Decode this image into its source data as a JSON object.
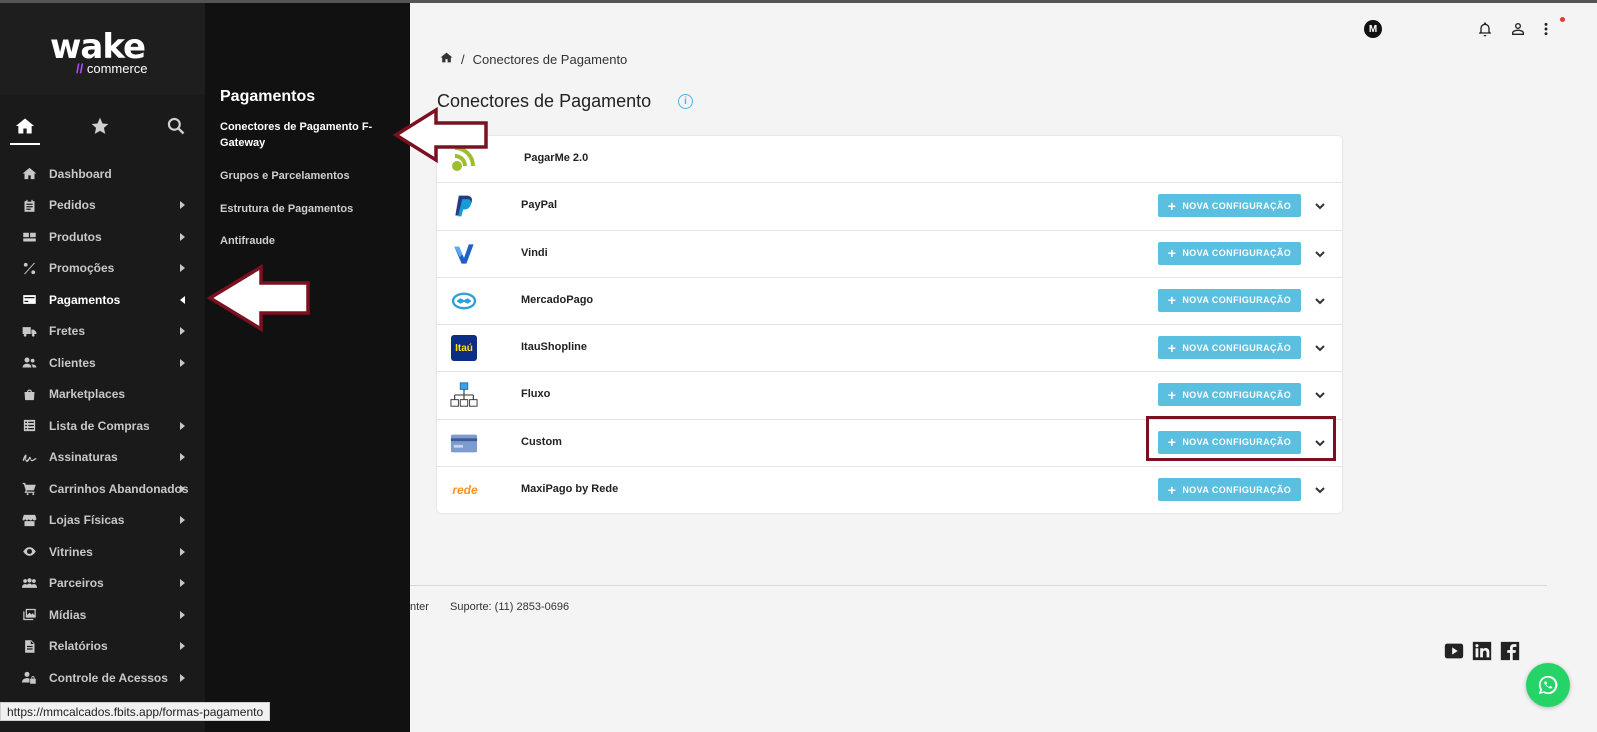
{
  "brand": {
    "logo_main": "wake",
    "logo_sub": "commerce",
    "logo_slash": "//"
  },
  "sidebar": {
    "tabs": [
      {
        "icon": "home-icon",
        "active": true
      },
      {
        "icon": "star-icon"
      },
      {
        "icon": "search-icon"
      }
    ],
    "items": [
      {
        "label": "Dashboard",
        "icon": "dashboard-icon",
        "has_sub": false
      },
      {
        "label": "Pedidos",
        "icon": "clipboard-icon",
        "has_sub": true
      },
      {
        "label": "Produtos",
        "icon": "boxes-icon",
        "has_sub": true
      },
      {
        "label": "Promoções",
        "icon": "percent-icon",
        "has_sub": true
      },
      {
        "label": "Pagamentos",
        "icon": "credit-card-icon",
        "has_sub": true,
        "active": true
      },
      {
        "label": "Fretes",
        "icon": "truck-icon",
        "has_sub": true
      },
      {
        "label": "Clientes",
        "icon": "users-icon",
        "has_sub": true
      },
      {
        "label": "Marketplaces",
        "icon": "shopping-bag-icon",
        "has_sub": false
      },
      {
        "label": "Lista de Compras",
        "icon": "list-icon",
        "has_sub": true
      },
      {
        "label": "Assinaturas",
        "icon": "signature-icon",
        "has_sub": true
      },
      {
        "label": "Carrinhos Abandonados",
        "icon": "cart-icon",
        "has_sub": true
      },
      {
        "label": "Lojas Físicas",
        "icon": "store-icon",
        "has_sub": true
      },
      {
        "label": "Vitrines",
        "icon": "eye-icon",
        "has_sub": true
      },
      {
        "label": "Parceiros",
        "icon": "partners-icon",
        "has_sub": true
      },
      {
        "label": "Mídias",
        "icon": "media-icon",
        "has_sub": true
      },
      {
        "label": "Relatórios",
        "icon": "report-icon",
        "has_sub": true
      },
      {
        "label": "Controle de Acessos",
        "icon": "user-lock-icon",
        "has_sub": true
      }
    ]
  },
  "submenu": {
    "title": "Pagamentos",
    "items": [
      {
        "label": "Conectores de Pagamento F-Gateway",
        "active": true
      },
      {
        "label": "Grupos e Parcelamentos"
      },
      {
        "label": "Estrutura de Pagamentos"
      },
      {
        "label": "Antifraude"
      }
    ]
  },
  "topbar": {
    "avatar_letter": "M"
  },
  "breadcrumb": {
    "current": "Conectores de Pagamento"
  },
  "page": {
    "title": "Conectores de Pagamento",
    "info_glyph": "i"
  },
  "connectors": {
    "button_label": "NOVA CONFIGURAÇÃO",
    "plus": "+",
    "rows": [
      {
        "name": "PagarMe 2.0",
        "logo": "pagarme-logo",
        "has_button": false
      },
      {
        "name": "PayPal",
        "logo": "paypal-logo",
        "has_button": true
      },
      {
        "name": "Vindi",
        "logo": "vindi-logo",
        "has_button": true
      },
      {
        "name": "MercadoPago",
        "logo": "mercadopago-logo",
        "has_button": true
      },
      {
        "name": "ItauShopline",
        "logo": "itau-logo",
        "has_button": true
      },
      {
        "name": "Fluxo",
        "logo": "fluxo-logo",
        "has_button": true
      },
      {
        "name": "Custom",
        "logo": "custom-card-logo",
        "has_button": true
      },
      {
        "name": "MaxiPago by Rede",
        "logo": "rede-logo",
        "has_button": true
      }
    ],
    "itau_text": "Itaú",
    "rede_text": "rede"
  },
  "footer": {
    "partial": "nter",
    "support": "Suporte: (11) 2853-0696"
  },
  "statusbar": {
    "url": "https://mmcalcados.fbits.app/formas-pagamento"
  },
  "colors": {
    "accent": "#5bbfe0",
    "highlight": "#7b1020",
    "sidebar": "#1a1a1a",
    "submenu": "#111111"
  }
}
